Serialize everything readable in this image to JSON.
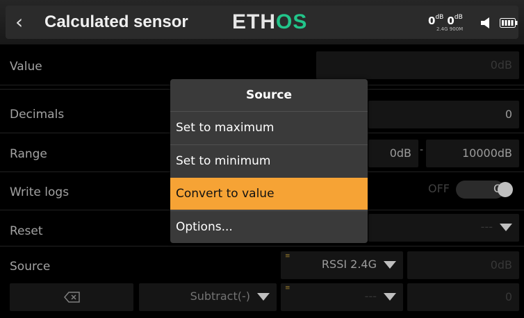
{
  "header": {
    "title": "Calculated sensor",
    "logo_white": "ETH",
    "logo_green": "OS",
    "rssi1": "0",
    "rssi1_unit": "dB",
    "rssi2": "0",
    "rssi2_unit": "dB",
    "rssi_sub": "2.4G 900M",
    "back_icon": "chevron-left-icon"
  },
  "rows": {
    "value_label": "Value",
    "value_field": "0dB",
    "decimals_label": "Decimals",
    "decimals_field": "0",
    "range_label": "Range",
    "range_min": "0dB",
    "range_sep": "-",
    "range_max": "10000dB",
    "writelogs_label": "Write logs",
    "writelogs_off": "OFF",
    "writelogs_on": "ON",
    "reset_label": "Reset",
    "reset_value": "---",
    "source_label": "Source",
    "source_value": "RSSI 2.4G",
    "source_field": "0dB",
    "op_value": "Subtract(-)",
    "source2_value": "---",
    "source2_field": "0"
  },
  "popup": {
    "title": "Source",
    "items": [
      "Set to maximum",
      "Set to minimum",
      "Convert to value",
      "Options..."
    ],
    "selected_index": 2
  },
  "colors": {
    "accent": "#f6a335",
    "logo_green": "#22c58a"
  }
}
